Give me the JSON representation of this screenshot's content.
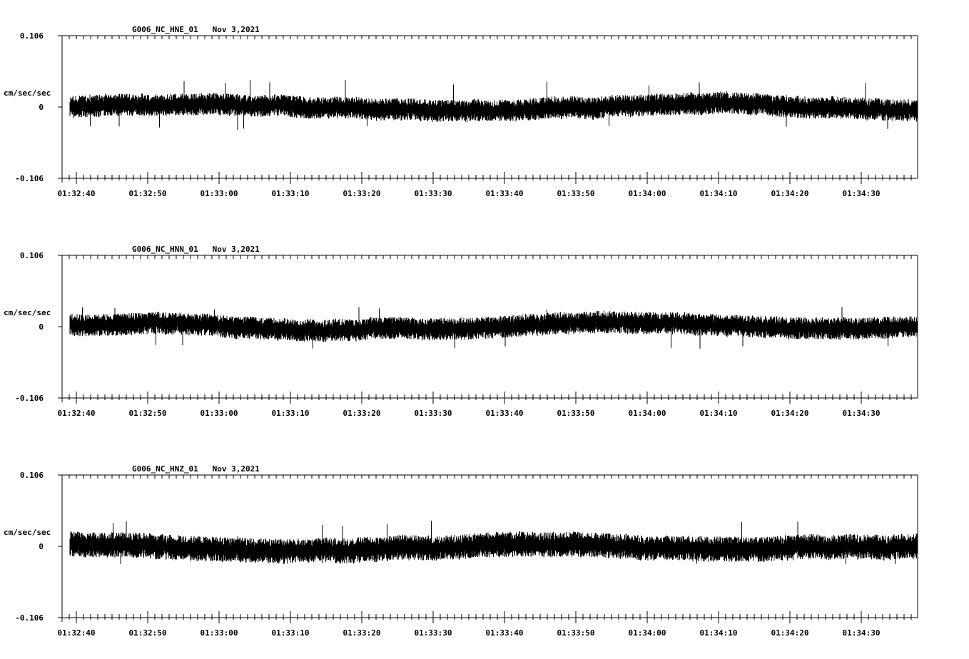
{
  "chart_data": [
    {
      "type": "line",
      "title": "G006_NC_HNE_01   Nov 3,2021",
      "ylabel": "cm/sec/sec",
      "ylim": [
        -0.106,
        0.106
      ],
      "y_ticks": [
        "0.106",
        "0",
        "-0.106"
      ],
      "x_ticks": [
        "01:32:40",
        "01:32:50",
        "01:33:00",
        "01:33:10",
        "01:33:20",
        "01:33:30",
        "01:33:40",
        "01:33:50",
        "01:34:00",
        "01:34:10",
        "01:34:20",
        "01:34:30"
      ],
      "x_range": [
        "01:32:39",
        "01:34:38"
      ],
      "series": [
        {
          "color": "#000000",
          "noise_amplitude_approx": 0.015,
          "peak_approx": 0.04,
          "trough_approx": -0.035
        }
      ]
    },
    {
      "type": "line",
      "title": "G006_NC_HNN_01   Nov 3,2021",
      "ylabel": "cm/sec/sec",
      "ylim": [
        -0.106,
        0.106
      ],
      "y_ticks": [
        "0.106",
        "0",
        "-0.106"
      ],
      "x_ticks": [
        "01:32:40",
        "01:32:50",
        "01:33:00",
        "01:33:10",
        "01:33:20",
        "01:33:30",
        "01:33:40",
        "01:33:50",
        "01:34:00",
        "01:34:10",
        "01:34:20",
        "01:34:30"
      ],
      "x_range": [
        "01:32:39",
        "01:34:38"
      ],
      "series": [
        {
          "color": "#000000",
          "noise_amplitude_approx": 0.015,
          "peak_approx": 0.03,
          "trough_approx": -0.034
        }
      ]
    },
    {
      "type": "line",
      "title": "G006_NC_HNZ_01   Nov 3,2021",
      "ylabel": "cm/sec/sec",
      "ylim": [
        -0.106,
        0.106
      ],
      "y_ticks": [
        "0.106",
        "0",
        "-0.106"
      ],
      "x_ticks": [
        "01:32:40",
        "01:32:50",
        "01:33:00",
        "01:33:10",
        "01:33:20",
        "01:33:30",
        "01:33:40",
        "01:33:50",
        "01:34:00",
        "01:34:10",
        "01:34:20",
        "01:34:30"
      ],
      "x_range": [
        "01:32:39",
        "01:34:38"
      ],
      "series": [
        {
          "color": "#000000",
          "noise_amplitude_approx": 0.017,
          "peak_approx": 0.038,
          "trough_approx": -0.032
        }
      ]
    }
  ]
}
